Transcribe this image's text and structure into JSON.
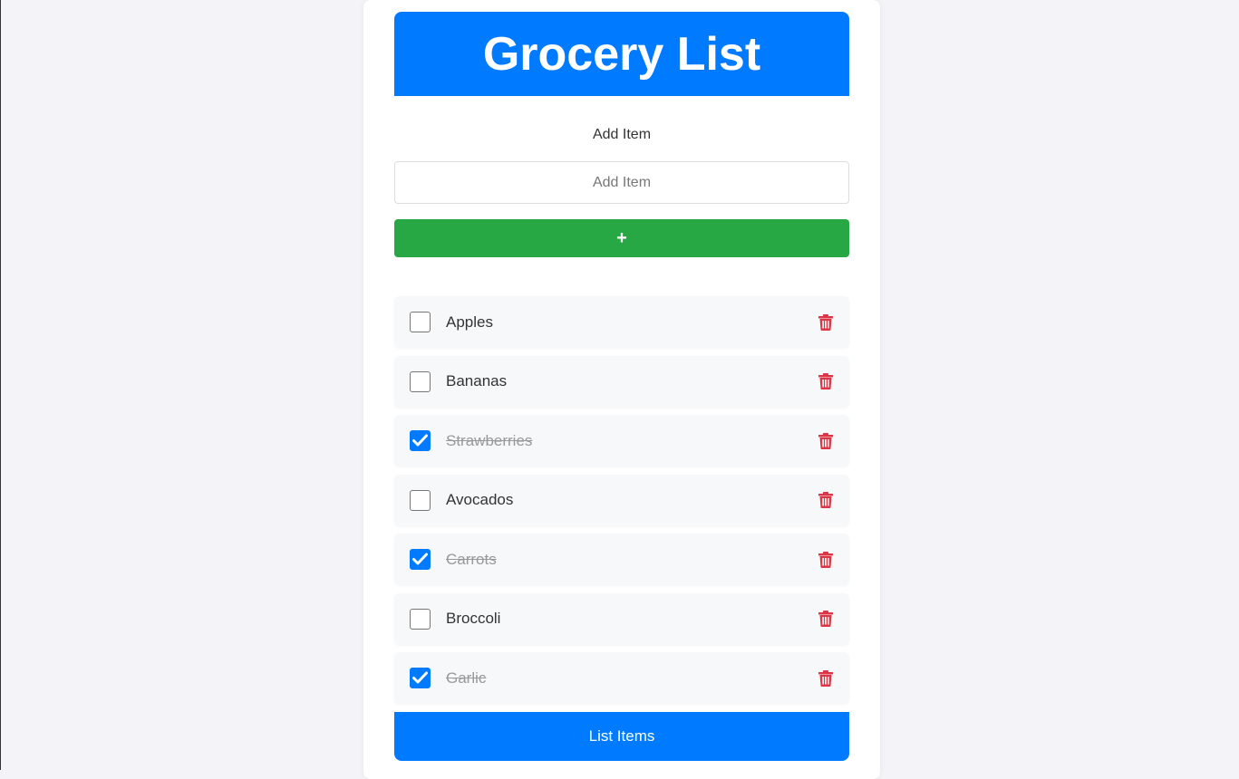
{
  "header": {
    "title": "Grocery List"
  },
  "add_form": {
    "label": "Add Item",
    "input_placeholder": "Add Item",
    "input_value": "",
    "add_button_label": "+"
  },
  "items": [
    {
      "label": "Apples",
      "checked": false
    },
    {
      "label": "Bananas",
      "checked": false
    },
    {
      "label": "Strawberries",
      "checked": true
    },
    {
      "label": "Avocados",
      "checked": false
    },
    {
      "label": "Carrots",
      "checked": true
    },
    {
      "label": "Broccoli",
      "checked": false
    },
    {
      "label": "Garlic",
      "checked": true
    }
  ],
  "footer": {
    "list_button_label": "List Items"
  },
  "colors": {
    "primary": "#007bff",
    "add_button": "#28a745",
    "delete_icon": "#dc3545"
  },
  "icons": {
    "checkbox_check": "check-icon",
    "delete": "trash-icon"
  }
}
